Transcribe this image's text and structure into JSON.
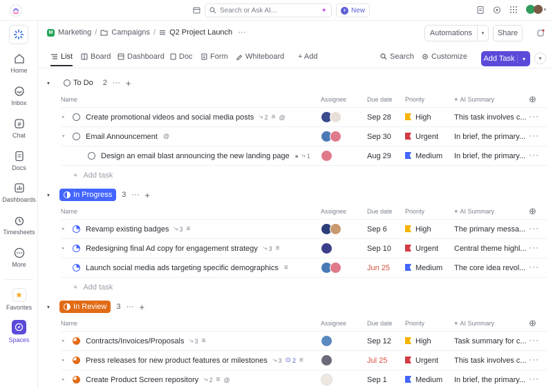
{
  "topbar": {
    "search_placeholder": "Search or Ask AI...",
    "new_label": "New"
  },
  "sidebar": {
    "items": [
      {
        "label": "Home",
        "icon": "home-icon"
      },
      {
        "label": "Inbox",
        "icon": "inbox-icon"
      },
      {
        "label": "Chat",
        "icon": "chat-icon"
      },
      {
        "label": "Docs",
        "icon": "docs-icon"
      },
      {
        "label": "Dashboards",
        "icon": "dashboards-icon"
      },
      {
        "label": "Timesheets",
        "icon": "timesheets-icon"
      },
      {
        "label": "More",
        "icon": "more-icon"
      },
      {
        "label": "Favorites",
        "icon": "star-icon"
      },
      {
        "label": "Spaces",
        "icon": "compass-icon"
      }
    ]
  },
  "breadcrumb": {
    "space_badge": "M",
    "space": "Marketing",
    "folder": "Campaigns",
    "list": "Q2 Project Launch",
    "sep": "/",
    "dots": "···"
  },
  "header": {
    "automations_label": "Automations",
    "share_label": "Share"
  },
  "view_tabs": {
    "tabs": [
      "List",
      "Board",
      "Dashboard",
      "Doc",
      "Form",
      "Whiteboard"
    ],
    "add_label": "+ Add",
    "search_label": "Search",
    "customize_label": "Customize",
    "add_task_label": "Add Task"
  },
  "columns": {
    "name": "Name",
    "assignee": "Assignee",
    "due": "Due date",
    "priority": "Priority",
    "ai": "AI Summary"
  },
  "colors": {
    "accent": "#5b4ad9",
    "todo": "#2a2e34",
    "in_progress": "#4466ff",
    "in_review": "#e16b16",
    "high": "#f5b400",
    "urgent": "#d33d44",
    "medium": "#4466ff",
    "overdue": "#d6503a"
  },
  "groups": [
    {
      "status": "To Do",
      "count": "2",
      "add_task": "Add task",
      "tasks": [
        {
          "name": "Create promotional videos and social media posts",
          "subtasks": "2",
          "due": "Sep 28",
          "priority": "High",
          "ai": "This task involves c..."
        },
        {
          "name": "Email Announcement",
          "due": "Sep 30",
          "priority": "Urgent",
          "ai": "In brief, the primary..."
        },
        {
          "name": "Design an email blast announcing the new landing page",
          "subtasks": "1",
          "due": "Aug 29",
          "priority": "Medium",
          "ai": "In brief, the primary..."
        }
      ]
    },
    {
      "status": "In Progress",
      "count": "3",
      "add_task": "Add task",
      "tasks": [
        {
          "name": "Revamp existing badges",
          "subtasks": "3",
          "due": "Sep 6",
          "priority": "High",
          "ai": "The primary messa..."
        },
        {
          "name": "Redesigning final Ad copy for engagement strategy",
          "subtasks": "3",
          "due": "Sep 10",
          "priority": "Urgent",
          "ai": "Central theme highl..."
        },
        {
          "name": "Launch social media ads targeting specific demographics",
          "due": "Jun 25",
          "priority": "Medium",
          "ai": "The core idea revol..."
        }
      ]
    },
    {
      "status": "In Review",
      "count": "3",
      "tasks": [
        {
          "name": "Contracts/Invoices/Proposals",
          "subtasks": "3",
          "due": "Sep 12",
          "priority": "High",
          "ai": "Task summary for c..."
        },
        {
          "name": "Press releases for new product features or milestones",
          "subtasks": "3",
          "watchers": "2",
          "due": "Jul 25",
          "priority": "Urgent",
          "ai": "This task involves c..."
        },
        {
          "name": "Create Product Screen repository",
          "subtasks": "2",
          "due": "Sep 1",
          "priority": "Medium",
          "ai": "In brief, the primary..."
        }
      ]
    }
  ]
}
